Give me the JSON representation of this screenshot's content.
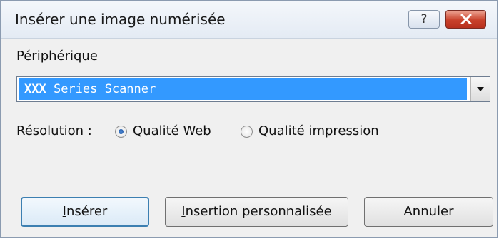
{
  "window": {
    "title": "Insérer une image numérisée",
    "help_label": "?"
  },
  "device": {
    "label_first": "P",
    "label_rest": "ériphérique",
    "selected_bold": "XXX",
    "selected_rest": " Series Scanner"
  },
  "resolution": {
    "label": "Résolution :",
    "web_prefix": "Qualité ",
    "web_mnemonic": "W",
    "web_rest": "eb",
    "web_selected": true,
    "print_mnemonic": "Q",
    "print_rest": "ualité impression",
    "print_selected": false
  },
  "buttons": {
    "insert_mnemonic": "I",
    "insert_rest": "nsérer",
    "custom_mnemonic": "I",
    "custom_rest": "nsertion personnalisée",
    "cancel": "Annuler"
  }
}
